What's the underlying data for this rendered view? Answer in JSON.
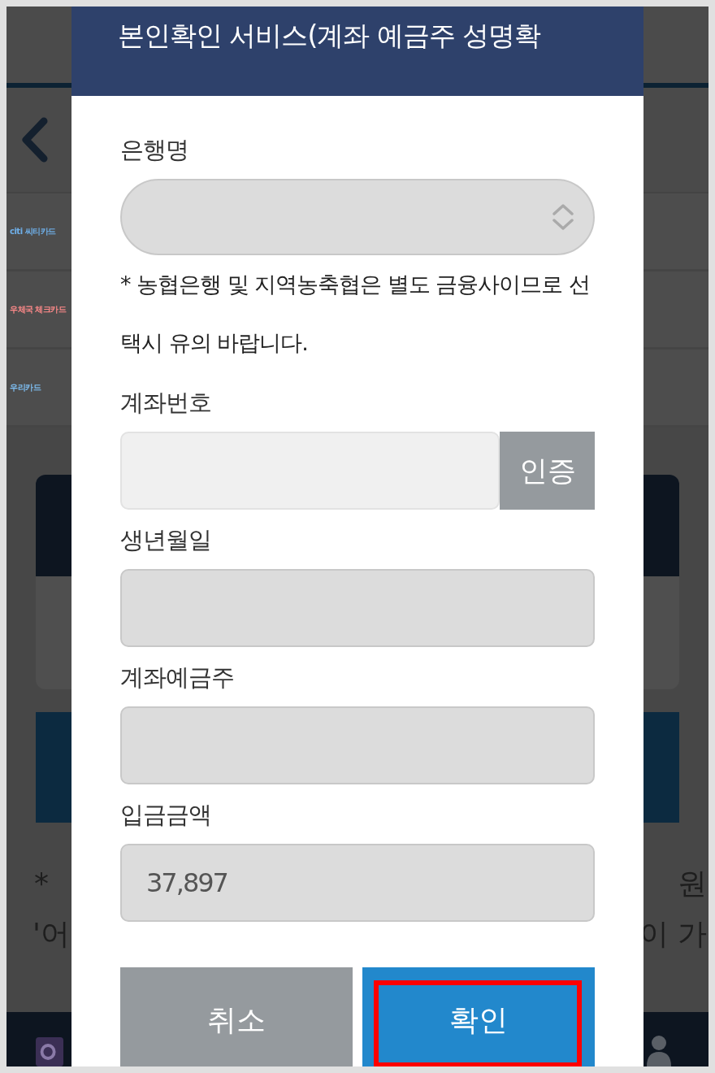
{
  "background": {
    "card_list": [
      {
        "logo": "citi 씨티카드",
        "color": "#6fb0ea"
      },
      {
        "logo": "우체국 체크카드",
        "color": "#ff8a8a"
      },
      {
        "logo": "우리카드",
        "color": "#7fc0f5"
      }
    ],
    "notice_lines": [
      {
        "left": "*",
        "right": "원"
      },
      {
        "left": "'어",
        "right": "이 가"
      }
    ]
  },
  "dialog": {
    "title": "본인확인 서비스(계좌 예금주 성명확",
    "fields": [
      {
        "label": "은행명",
        "kind": "select",
        "disabled": true,
        "note": "* 농협은행 및 지역농축협은 별도 금융사이므로 선택시 유의 바랍니다."
      },
      {
        "label": "계좌번호",
        "kind": "input",
        "disabled": false,
        "button": "인증"
      },
      {
        "label": "생년월일",
        "kind": "input",
        "disabled": true
      },
      {
        "label": "계좌예금주",
        "kind": "input",
        "disabled": true
      },
      {
        "label": "입금금액",
        "kind": "input",
        "disabled": true,
        "value": "37,897"
      }
    ],
    "buttons": [
      {
        "label": "취소",
        "kind": "cancel",
        "highlighted": false
      },
      {
        "label": "확인",
        "kind": "confirm",
        "highlighted": true
      }
    ]
  }
}
